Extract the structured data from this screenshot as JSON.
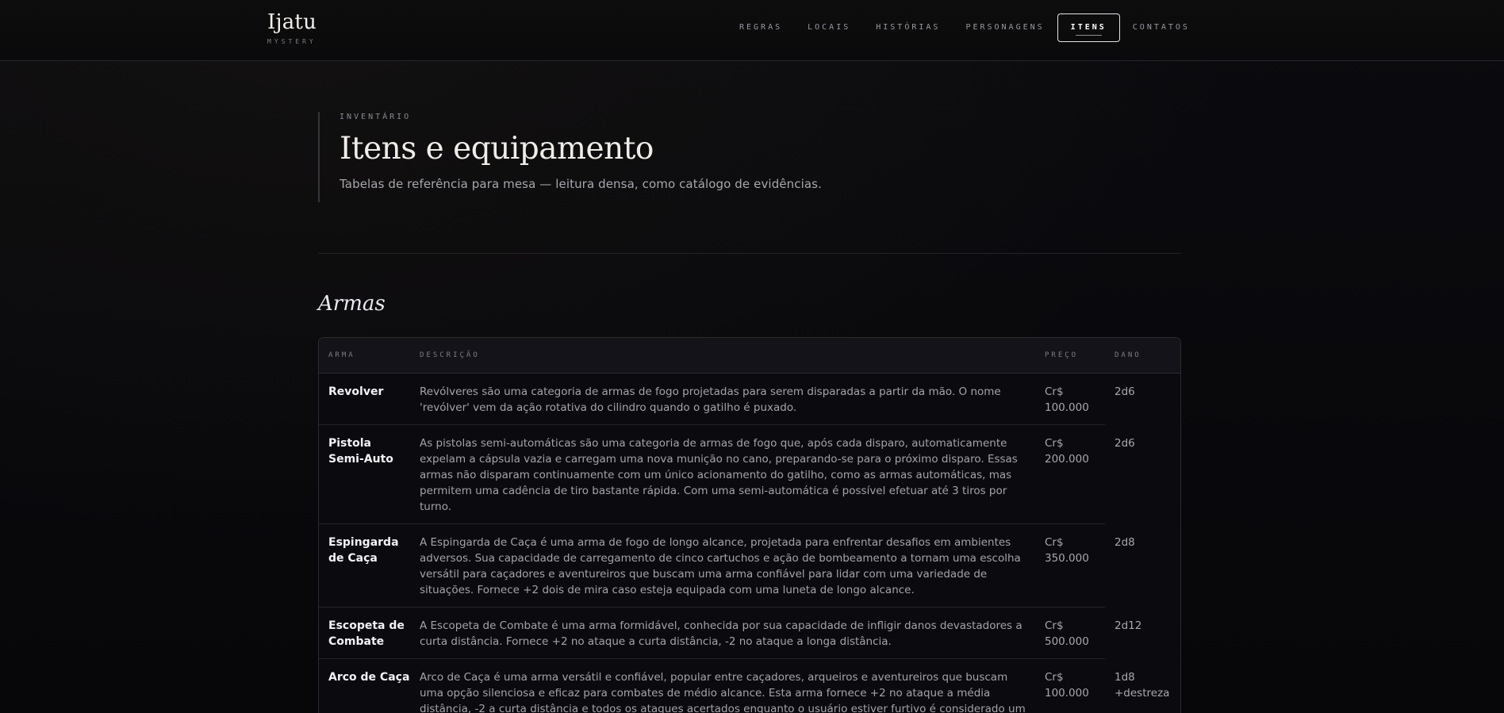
{
  "brand": {
    "name": "Ijatu",
    "sub": "MYSTERY"
  },
  "nav": [
    {
      "label": "REGRAS"
    },
    {
      "label": "LOCAIS"
    },
    {
      "label": "HISTÓRIAS"
    },
    {
      "label": "PERSONAGENS"
    },
    {
      "label": "ITENS",
      "active": true
    },
    {
      "label": "CONTATOS"
    }
  ],
  "hero": {
    "eyebrow": "INVENTÁRIO",
    "title": "Itens e equipamento",
    "subtitle": "Tabelas de referência para mesa — leitura densa, como catálogo de evidências."
  },
  "section": {
    "title": "Armas"
  },
  "table": {
    "headers": [
      "ARMA",
      "DESCRIÇÃO",
      "PREÇO",
      "DANO"
    ],
    "rows": [
      {
        "name": "Revolver",
        "desc": "Revólveres são uma categoria de armas de fogo projetadas para serem disparadas a partir da mão. O nome 'revólver' vem da ação rotativa do cilindro quando o gatilho é puxado.",
        "price": "Cr$ 100.000",
        "dmg": "2d6"
      },
      {
        "name": "Pistola Semi-Auto",
        "desc": "As pistolas semi-automáticas são uma categoria de armas de fogo que, após cada disparo, automaticamente expelam a cápsula vazia e carregam uma nova munição no cano, preparando-se para o próximo disparo. Essas armas não disparam continuamente com um único acionamento do gatilho, como as armas automáticas, mas permitem uma cadência de tiro bastante rápida. Com uma semi-automática é possível efetuar até 3 tiros por turno.",
        "price": "Cr$ 200.000",
        "dmg": "2d6"
      },
      {
        "name": "Espingarda de Caça",
        "desc": "A Espingarda de Caça é uma arma de fogo de longo alcance, projetada para enfrentar desafios em ambientes adversos. Sua capacidade de carregamento de cinco cartuchos e ação de bombeamento a tornam uma escolha versátil para caçadores e aventureiros que buscam uma arma confiável para lidar com uma variedade de situações. Fornece +2 dois de mira caso esteja equipada com uma luneta de longo alcance.",
        "price": "Cr$ 350.000",
        "dmg": "2d8"
      },
      {
        "name": "Escopeta de Combate",
        "desc": "A Escopeta de Combate é uma arma formidável, conhecida por sua capacidade de infligir danos devastadores a curta distância. Fornece +2 no ataque a curta distância, -2 no ataque a longa distância.",
        "price": "Cr$ 500.000",
        "dmg": "2d12"
      },
      {
        "name": "Arco de Caça",
        "desc": "Arco de Caça é uma arma versátil e confiável, popular entre caçadores, arqueiros e aventureiros que buscam uma opção silenciosa e eficaz para combates de médio alcance. Esta arma fornece +2 no ataque a média distância, -2 a curta distância e todos os ataques acertados enquanto o usuário estiver furtivo é considerado um ataque crítico.",
        "price": "Cr$ 100.000",
        "dmg": "1d8 +destreza"
      }
    ]
  }
}
